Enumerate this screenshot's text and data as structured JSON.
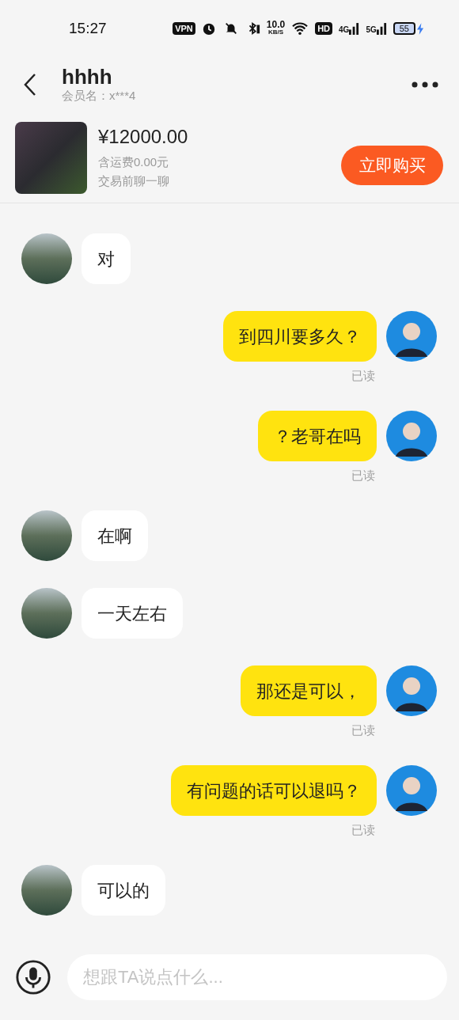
{
  "status_bar": {
    "time": "15:27",
    "vpn": "VPN",
    "speed_value": "10.0",
    "speed_unit": "KB/S",
    "hd": "HD",
    "network_1": "4G",
    "network_2": "5G",
    "battery": "55"
  },
  "header": {
    "title": "hhhh",
    "member": "会员名：x***4"
  },
  "product": {
    "price": "¥12000.00",
    "shipping": "含运费0.00元",
    "note": "交易前聊一聊",
    "buy_button": "立即购买"
  },
  "messages": [
    {
      "kind": "incoming",
      "text": "对"
    },
    {
      "kind": "outgoing",
      "text": "到四川要多久？",
      "receipt": "已读"
    },
    {
      "kind": "outgoing",
      "text": "？老哥在吗",
      "receipt": "已读"
    },
    {
      "kind": "incoming",
      "text": "在啊"
    },
    {
      "kind": "incoming",
      "text": "一天左右"
    },
    {
      "kind": "outgoing",
      "text": "那还是可以，",
      "receipt": "已读"
    },
    {
      "kind": "outgoing",
      "text": "有问题的话可以退吗？",
      "receipt": "已读"
    },
    {
      "kind": "incoming",
      "text": "可以的"
    }
  ],
  "input": {
    "placeholder": "想跟TA说点什么..."
  }
}
